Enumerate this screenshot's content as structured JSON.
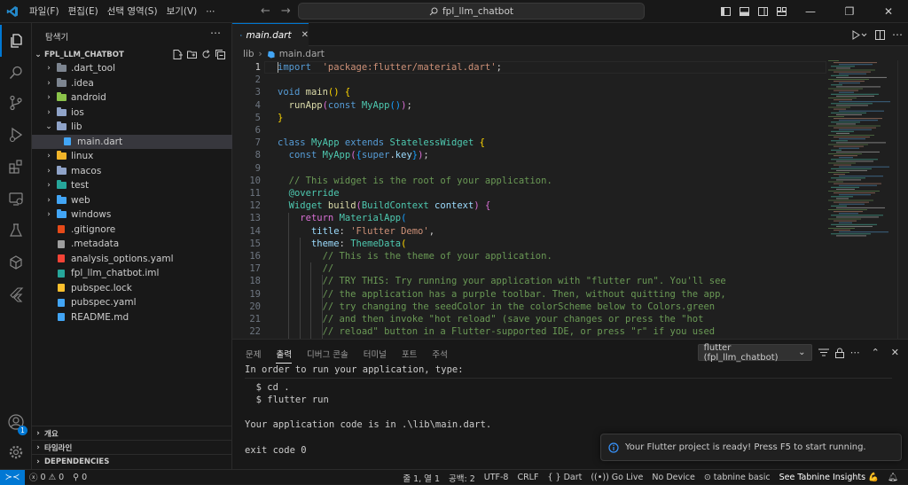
{
  "titlebar": {
    "menu": [
      "파일(F)",
      "편집(E)",
      "선택 영역(S)",
      "보기(V)",
      "⋯"
    ],
    "search_text": "fpl_llm_chatbot"
  },
  "sidebar": {
    "title": "탐색기",
    "project": "FPL_LLM_CHATBOT",
    "tree": [
      {
        "label": ".dart_tool",
        "kind": "folder",
        "depth": 1,
        "color": "#7d8590"
      },
      {
        "label": ".idea",
        "kind": "folder",
        "depth": 1,
        "color": "#7d8590"
      },
      {
        "label": "android",
        "kind": "folder",
        "depth": 1,
        "color": "#8bc34a"
      },
      {
        "label": "ios",
        "kind": "folder",
        "depth": 1,
        "color": "#8fa3c8"
      },
      {
        "label": "lib",
        "kind": "folder-open",
        "depth": 1,
        "color": "#8fa3c8"
      },
      {
        "label": "main.dart",
        "kind": "dart",
        "depth": 2,
        "color": "#42a5f5",
        "selected": true
      },
      {
        "label": "linux",
        "kind": "folder",
        "depth": 1,
        "color": "#f0b429"
      },
      {
        "label": "macos",
        "kind": "folder",
        "depth": 1,
        "color": "#8fa3c8"
      },
      {
        "label": "test",
        "kind": "folder",
        "depth": 1,
        "color": "#26a69a"
      },
      {
        "label": "web",
        "kind": "folder",
        "depth": 1,
        "color": "#42a5f5"
      },
      {
        "label": "windows",
        "kind": "folder",
        "depth": 1,
        "color": "#42a5f5"
      },
      {
        "label": ".gitignore",
        "kind": "git",
        "depth": 1,
        "color": "#e64a19"
      },
      {
        "label": ".metadata",
        "kind": "file",
        "depth": 1,
        "color": "#9e9e9e"
      },
      {
        "label": "analysis_options.yaml",
        "kind": "yaml",
        "depth": 1,
        "color": "#f44336"
      },
      {
        "label": "fpl_llm_chatbot.iml",
        "kind": "iml",
        "depth": 1,
        "color": "#26a69a"
      },
      {
        "label": "pubspec.lock",
        "kind": "lock",
        "depth": 1,
        "color": "#fbc02d"
      },
      {
        "label": "pubspec.yaml",
        "kind": "dart",
        "depth": 1,
        "color": "#42a5f5"
      },
      {
        "label": "README.md",
        "kind": "md",
        "depth": 1,
        "color": "#42a5f5"
      }
    ],
    "bottom_sections": [
      "개요",
      "타임라인",
      "DEPENDENCIES"
    ]
  },
  "editor": {
    "tab_label": "main.dart",
    "breadcrumb": [
      "lib",
      "main.dart"
    ],
    "current_line": 1,
    "lines": [
      [
        [
          "k",
          "import"
        ],
        [
          "",
          "  "
        ],
        [
          "s",
          "'package:flutter/material.dart'"
        ],
        [
          "",
          ";"
        ]
      ],
      [],
      [
        [
          "k",
          "void"
        ],
        [
          "",
          " "
        ],
        [
          "f",
          "main"
        ],
        [
          "y",
          "()"
        ],
        [
          "",
          " "
        ],
        [
          "y",
          "{"
        ]
      ],
      [
        [
          "",
          "  "
        ],
        [
          "f",
          "runApp"
        ],
        [
          "p",
          "("
        ],
        [
          "k",
          "const"
        ],
        [
          "",
          " "
        ],
        [
          "t",
          "MyApp"
        ],
        [
          "b",
          "()"
        ],
        [
          "p",
          ")"
        ],
        [
          "",
          ";"
        ]
      ],
      [
        [
          "y",
          "}"
        ]
      ],
      [],
      [
        [
          "k",
          "class"
        ],
        [
          "",
          " "
        ],
        [
          "t",
          "MyApp"
        ],
        [
          "",
          " "
        ],
        [
          "k",
          "extends"
        ],
        [
          "",
          " "
        ],
        [
          "t",
          "StatelessWidget"
        ],
        [
          "",
          " "
        ],
        [
          "y",
          "{"
        ]
      ],
      [
        [
          "",
          "  "
        ],
        [
          "k",
          "const"
        ],
        [
          "",
          " "
        ],
        [
          "t",
          "MyApp"
        ],
        [
          "p",
          "("
        ],
        [
          "b",
          "{"
        ],
        [
          "k",
          "super"
        ],
        [
          "",
          ".",
          ""
        ],
        [
          "v",
          "key"
        ],
        [
          "b",
          "}"
        ],
        [
          "p",
          ")"
        ],
        [
          "",
          ";"
        ]
      ],
      [],
      [
        [
          "",
          "  "
        ],
        [
          "c",
          "// This widget is the root of your application."
        ]
      ],
      [
        [
          "",
          "  "
        ],
        [
          "t",
          "@override"
        ]
      ],
      [
        [
          "",
          "  "
        ],
        [
          "t",
          "Widget"
        ],
        [
          "",
          " "
        ],
        [
          "f",
          "build"
        ],
        [
          "p",
          "("
        ],
        [
          "t",
          "BuildContext"
        ],
        [
          "",
          " "
        ],
        [
          "v",
          "context"
        ],
        [
          "p",
          ")"
        ],
        [
          "",
          " "
        ],
        [
          "p",
          "{"
        ]
      ],
      [
        [
          "",
          "    "
        ],
        [
          "p",
          "return"
        ],
        [
          "",
          " "
        ],
        [
          "t",
          "MaterialApp"
        ],
        [
          "b",
          "("
        ]
      ],
      [
        [
          "",
          "      "
        ],
        [
          "v",
          "title"
        ],
        [
          "",
          ": "
        ],
        [
          "s",
          "'Flutter Demo'"
        ],
        [
          "",
          ","
        ]
      ],
      [
        [
          "",
          "      "
        ],
        [
          "v",
          "theme"
        ],
        [
          "",
          ": "
        ],
        [
          "t",
          "ThemeData"
        ],
        [
          "y",
          "("
        ]
      ],
      [
        [
          "",
          "        "
        ],
        [
          "c",
          "// This is the theme of your application."
        ]
      ],
      [
        [
          "",
          "        "
        ],
        [
          "c",
          "//"
        ]
      ],
      [
        [
          "",
          "        "
        ],
        [
          "c",
          "// TRY THIS: Try running your application with \"flutter run\". You'll see"
        ]
      ],
      [
        [
          "",
          "        "
        ],
        [
          "c",
          "// the application has a purple toolbar. Then, without quitting the app,"
        ]
      ],
      [
        [
          "",
          "        "
        ],
        [
          "c",
          "// try changing the seedColor in the colorScheme below to Colors.green"
        ]
      ],
      [
        [
          "",
          "        "
        ],
        [
          "c",
          "// and then invoke \"hot reload\" (save your changes or press the \"hot"
        ]
      ],
      [
        [
          "",
          "        "
        ],
        [
          "c",
          "// reload\" button in a Flutter-supported IDE, or press \"r\" if you used"
        ]
      ]
    ]
  },
  "panel": {
    "tabs": [
      "문제",
      "출력",
      "디버그 콘솔",
      "터미널",
      "포트",
      "주석"
    ],
    "active_tab": "출력",
    "channel": "flutter (fpl_llm_chatbot)",
    "output_lines": [
      "In order to run your application, type:",
      "",
      "  $ cd .",
      "  $ flutter run",
      "",
      "Your application code is in .\\lib\\main.dart.",
      "",
      "exit code 0"
    ]
  },
  "notification": {
    "message": "Your Flutter project is ready! Press F5 to start running."
  },
  "statusbar": {
    "errors": "0",
    "warnings": "0",
    "ports": "0",
    "position": "줄 1, 열 1",
    "spaces": "공백: 2",
    "encoding": "UTF-8",
    "eol": "CRLF",
    "language": "Dart",
    "golive": "Go Live",
    "device": "No Device",
    "tabnine": "tabnine basic",
    "insights": "See Tabnine Insights 💪"
  },
  "accounts_badge": "1",
  "colors": {
    "accent": "#0078d4",
    "background": "#1f1f1f",
    "sidebar": "#181818"
  }
}
